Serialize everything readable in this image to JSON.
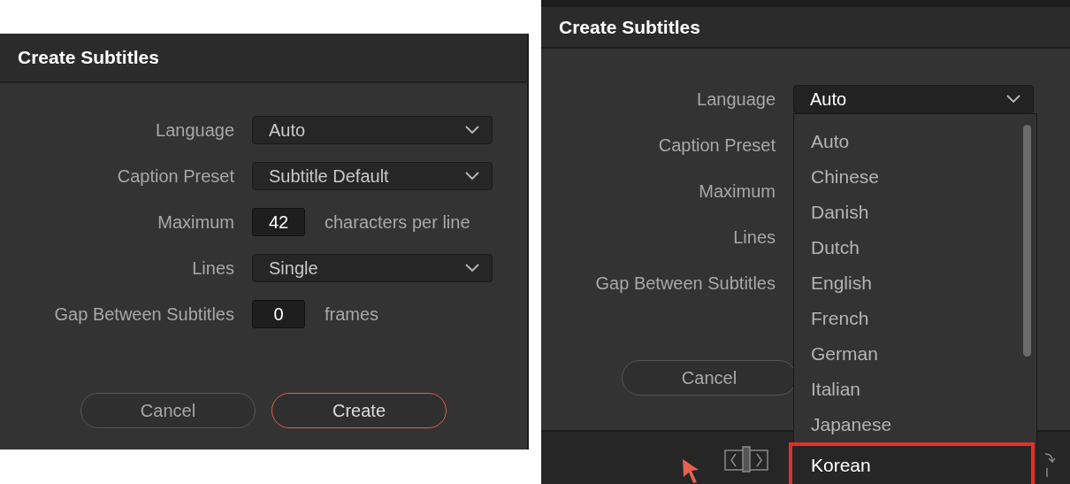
{
  "panels": [
    {
      "title": "Create Subtitles",
      "toolbar": false,
      "fields": [
        {
          "label": "Language",
          "kind": "dropdown",
          "value": "Auto"
        },
        {
          "label": "Caption Preset",
          "kind": "dropdown",
          "value": "Subtitle Default"
        },
        {
          "label": "Maximum",
          "kind": "number",
          "value": "42",
          "suffix": "characters per line"
        },
        {
          "label": "Lines",
          "kind": "dropdown",
          "value": "Single"
        },
        {
          "label": "Gap Between Subtitles",
          "kind": "number",
          "value": "0",
          "suffix": "frames"
        }
      ],
      "buttons": [
        {
          "label": "Cancel",
          "kind": "secondary"
        },
        {
          "label": "Create",
          "kind": "primary"
        }
      ]
    },
    {
      "title": "Create Subtitles",
      "toolbar": true,
      "fields": [
        {
          "label": "Language",
          "kind": "dropdown",
          "value": "Auto",
          "expanded": true
        },
        {
          "label": "Caption Preset",
          "kind": "covered"
        },
        {
          "label": "Maximum",
          "kind": "covered"
        },
        {
          "label": "Lines",
          "kind": "covered"
        },
        {
          "label": "Gap Between Subtitles",
          "kind": "covered"
        }
      ],
      "buttons": [
        {
          "label": "Cancel",
          "kind": "secondary"
        }
      ],
      "dropdown_list": {
        "options": [
          {
            "label": "Auto",
            "selected": false
          },
          {
            "label": "Chinese",
            "selected": false
          },
          {
            "label": "Danish",
            "selected": false
          },
          {
            "label": "Dutch",
            "selected": false
          },
          {
            "label": "English",
            "selected": false
          },
          {
            "label": "French",
            "selected": false
          },
          {
            "label": "German",
            "selected": false
          },
          {
            "label": "Italian",
            "selected": false
          },
          {
            "label": "Japanese",
            "selected": false
          },
          {
            "label": "Korean",
            "selected": true
          }
        ]
      }
    }
  ]
}
